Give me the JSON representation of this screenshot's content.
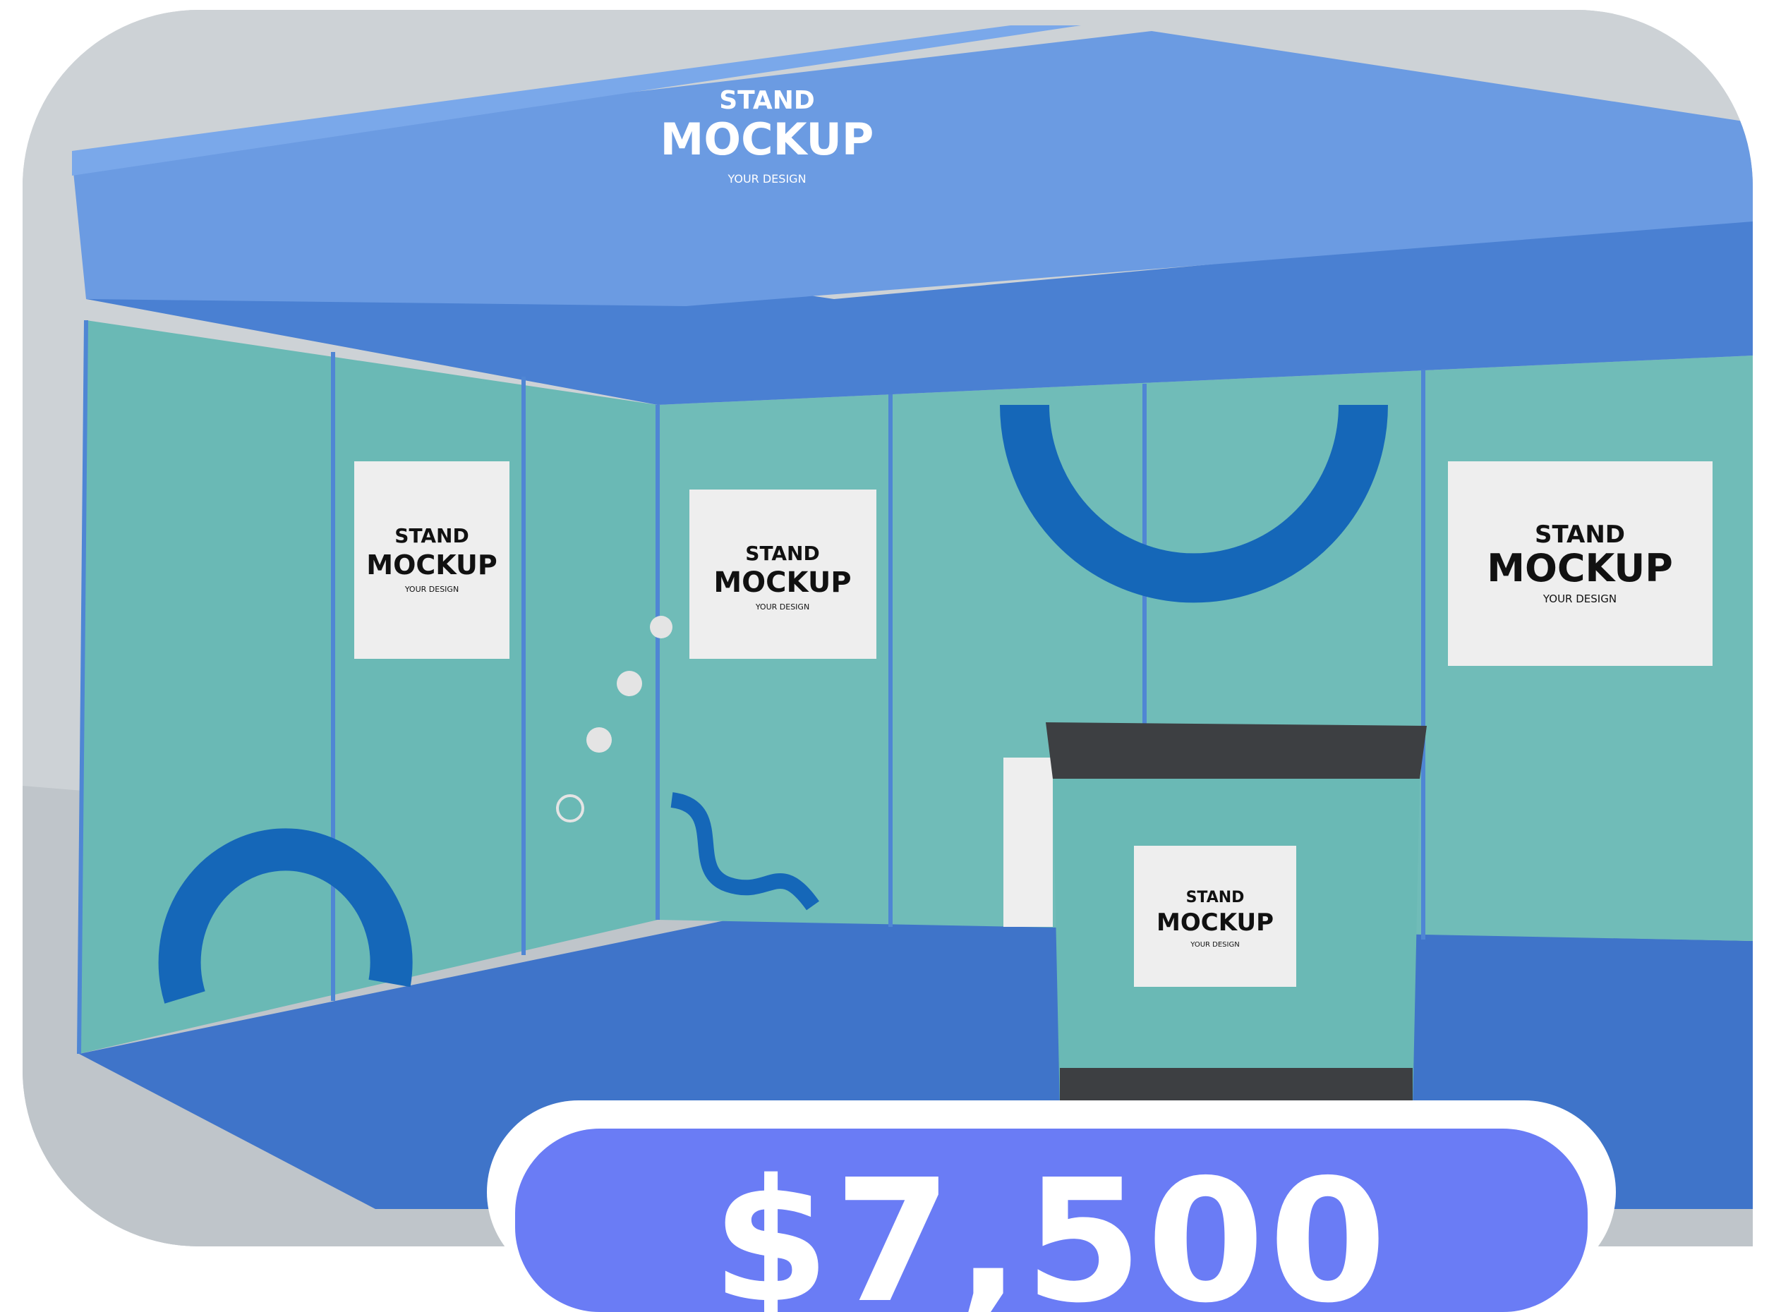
{
  "image": {
    "subject": "exhibition booth mockup",
    "signs": {
      "header": {
        "line1": "STAND",
        "line2": "MOCKUP",
        "line3": "YOUR DESIGN"
      },
      "poster_left": {
        "line1": "STAND",
        "line2": "MOCKUP",
        "line3": "YOUR DESIGN"
      },
      "poster_center": {
        "line1": "STAND",
        "line2": "MOCKUP",
        "line3": "YOUR DESIGN"
      },
      "poster_right": {
        "line1": "STAND",
        "line2": "MOCKUP",
        "line3": "YOUR DESIGN"
      },
      "counter": {
        "line1": "STAND",
        "line2": "MOCKUP",
        "line3": "YOUR DESIGN"
      }
    }
  },
  "price": {
    "label": "$7,500"
  },
  "colors": {
    "booth_blue": "#5b8ed8",
    "panel_teal": "#6ab9b5",
    "accent_dark_blue": "#1567b8",
    "price_pill": "#6a7cf5",
    "floor_blue": "#3f74c9"
  }
}
